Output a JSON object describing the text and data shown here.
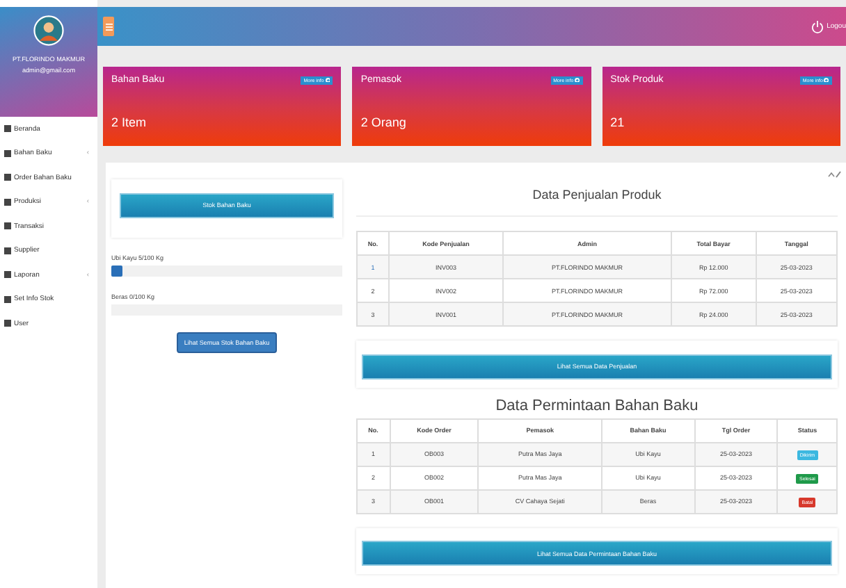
{
  "sidebar": {
    "company": "PT.FLORINDO MAKMUR",
    "email": "admin@gmail.com",
    "items": [
      {
        "label": "Beranda"
      },
      {
        "label": "Bahan Baku",
        "arrow": "‹"
      },
      {
        "label": "Order Bahan Baku"
      },
      {
        "label": "Produksi",
        "arrow": "‹"
      },
      {
        "label": "Transaksi"
      },
      {
        "label": "Supplier"
      },
      {
        "label": "Laporan",
        "arrow": "‹"
      },
      {
        "label": "Set Info Stok"
      },
      {
        "label": "User"
      }
    ]
  },
  "topbar": {
    "logout": "Logou"
  },
  "info_boxes": [
    {
      "title": "Bahan Baku",
      "value": "2 Item",
      "more": "More info"
    },
    {
      "title": "Pemasok",
      "value": "2 Orang",
      "more": "More info"
    },
    {
      "title": "Stok Produk",
      "value": "21",
      "more": "More info"
    }
  ],
  "stock": {
    "button": "Stok Bahan Baku",
    "items": [
      {
        "label": "Ubi Kayu 5/100 Kg",
        "level": 0.05
      },
      {
        "label": "Beras 0/100 Kg"
      }
    ],
    "link": "Lihat Semua Stok Bahan Baku"
  },
  "sales": {
    "title": "Data Penjualan Produk",
    "columns": [
      "No.",
      "Kode Penjualan",
      "Admin",
      "Total Bayar",
      "Tanggal"
    ],
    "rows": [
      [
        "1",
        "INV003",
        "PT.FLORINDO MAKMUR",
        "Rp 12.000",
        "25-03-2023"
      ],
      [
        "2",
        "INV002",
        "PT.FLORINDO MAKMUR",
        "Rp 72.000",
        "25-03-2023"
      ],
      [
        "3",
        "INV001",
        "PT.FLORINDO MAKMUR",
        "Rp 24.000",
        "25-03-2023"
      ]
    ],
    "button": "Lihat Semua Data Penjualan"
  },
  "orders": {
    "title": "Data Permintaan Bahan Baku",
    "columns": [
      "No.",
      "Kode Order",
      "Pemasok",
      "Bahan Baku",
      "Tgl Order",
      "Status"
    ],
    "rows": [
      {
        "cells": [
          "1",
          "OB003",
          "Putra Mas Jaya",
          "Ubi Kayu",
          "25-03-2023"
        ],
        "status": "Dikirim",
        "kind": "info"
      },
      {
        "cells": [
          "2",
          "OB002",
          "Putra Mas Jaya",
          "Ubi Kayu",
          "25-03-2023"
        ],
        "status": "Selesai",
        "kind": "success"
      },
      {
        "cells": [
          "3",
          "OB001",
          "CV Cahaya Sejati",
          "Beras",
          "25-03-2023"
        ],
        "status": "Batal",
        "kind": "danger"
      }
    ],
    "button": "Lihat Semua Data Permintaan Bahan Baku"
  }
}
